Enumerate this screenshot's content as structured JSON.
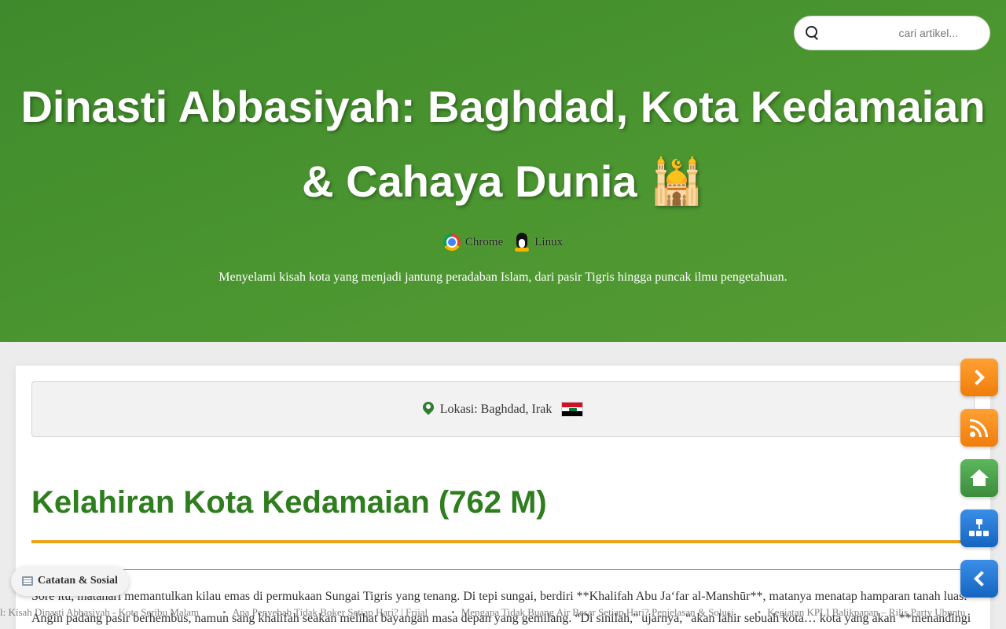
{
  "search": {
    "placeholder": "cari artikel..."
  },
  "hero": {
    "title_line1": "Dinasti Abbasiyah: Baghdad, Kota Kedamaian",
    "title_line2": "& Cahaya Dunia 🕌",
    "badges": [
      {
        "icon": "chrome-icon",
        "label": "Chrome"
      },
      {
        "icon": "linux-tux-icon",
        "label": "Linux"
      }
    ],
    "subtitle": "Menyelami kisah kota yang menjadi jantung peradaban Islam, dari pasir Tigris hingga puncak ilmu pengetahuan."
  },
  "article": {
    "location": "Lokasi: Baghdad, Irak",
    "location_flag": "iraq-flag",
    "section_title": "Kelahiran Kota Kedamaian (762 M)",
    "paragraph": "Sore itu, matahari memantulkan kilau emas di permukaan Sungai Tigris yang tenang. Di tepi sungai, berdiri **Khalifah Abu Ja‘far al-Manshūr**, matanya menatap hamparan tanah luas. Angin padang pasir berhembus, namun sang khalifah seakan melihat bayangan masa depan yang gemilang. “Di sinilah,” ujarnya, “akan lahir sebuah kota… kota yang akan **menandingi"
  },
  "floating_buttons": [
    {
      "name": "next-button",
      "icon": "chevron-right-icon",
      "color": "#f28c1a"
    },
    {
      "name": "rss-button",
      "icon": "rss-icon",
      "color": "#f28c1a"
    },
    {
      "name": "home-button",
      "icon": "home-icon",
      "color": "#4caf50"
    },
    {
      "name": "sitemap-button",
      "icon": "sitemap-icon",
      "color": "#1e88e5"
    },
    {
      "name": "back-button",
      "icon": "chevron-left-icon",
      "color": "#1e88e5"
    }
  ],
  "ticker": [
    "l: Kisah Dinasti Abbasiyah - Kota Seribu Malam",
    "Apa Penyebab Tidak Boker Setiap Hari? | Frijal",
    "Mengapa Tidak Buang Air Besar Setiap Hari? Penjelasan & Solusi",
    "Kegiatan KPLI Balikpapan – Rilis Party Ubuntu"
  ],
  "notes_chip": {
    "icon": "newspaper-icon",
    "label": "Catatan & Sosial"
  },
  "colors": {
    "hero_green": "#4a9530",
    "title_green": "#2e7d1f",
    "accent_orange": "#e8a317"
  }
}
